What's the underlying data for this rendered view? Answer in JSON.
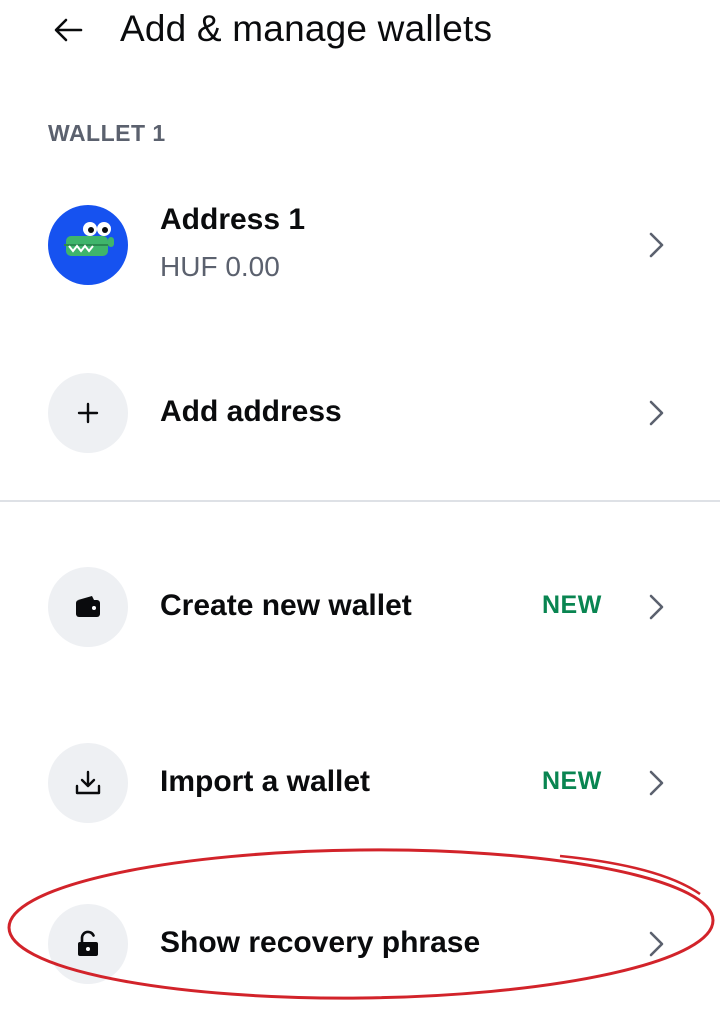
{
  "header": {
    "title": "Add & manage wallets",
    "back_icon": "arrow-left-icon"
  },
  "section": {
    "label": "WALLET 1"
  },
  "address": {
    "name": "Address 1",
    "balance": "HUF 0.00",
    "avatar": "crocodile-avatar"
  },
  "actions": [
    {
      "label": "Add address",
      "icon": "plus-icon",
      "badge": ""
    },
    {
      "label": "Create new wallet",
      "icon": "wallet-icon",
      "badge": "NEW"
    },
    {
      "label": "Import a wallet",
      "icon": "download-icon",
      "badge": "NEW"
    },
    {
      "label": "Show recovery phrase",
      "icon": "unlock-icon",
      "badge": ""
    }
  ],
  "colors": {
    "accent_blue": "#1652f0",
    "badge_green": "#098551",
    "icon_bg": "#eef0f3",
    "annotation_red": "#d2232a",
    "secondary_text": "#5b616e"
  }
}
